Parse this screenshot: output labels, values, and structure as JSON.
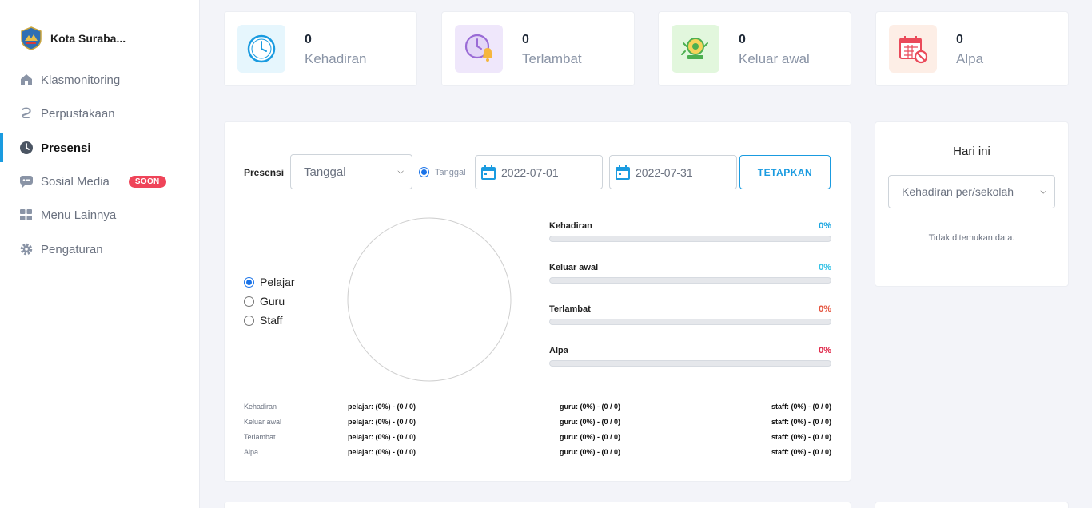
{
  "sidebar": {
    "brand": "Kota Suraba...",
    "items": [
      {
        "label": "Klasmonitoring",
        "icon": "home-icon"
      },
      {
        "label": "Perpustakaan",
        "icon": "library-icon"
      },
      {
        "label": "Presensi",
        "icon": "clock-icon",
        "active": true
      },
      {
        "label": "Sosial Media",
        "icon": "chat-icon",
        "badge": "SOON"
      },
      {
        "label": "Menu Lainnya",
        "icon": "grid-icon"
      },
      {
        "label": "Pengaturan",
        "icon": "gear-icon"
      }
    ]
  },
  "stats": [
    {
      "value": "0",
      "label": "Kehadiran",
      "icon": "clock-icon",
      "bg": "#e6f6fd",
      "color": "#1a9be0"
    },
    {
      "value": "0",
      "label": "Terlambat",
      "icon": "alarm-clock-icon",
      "bg": "#efe7fb",
      "color": "#9a6bd6"
    },
    {
      "value": "0",
      "label": "Keluar awal",
      "icon": "bell-icon",
      "bg": "#e2f7dd",
      "color": "#4caf50"
    },
    {
      "value": "0",
      "label": "Alpa",
      "icon": "calendar-cancel-icon",
      "bg": "#fdeee6",
      "color": "#ea4a5a"
    }
  ],
  "presensi": {
    "label": "Presensi",
    "period_select": "Tanggal",
    "radio_label": "Tanggal",
    "date_from": "2022-07-01",
    "date_to": "2022-07-31",
    "apply_label": "TETAPKAN",
    "roles": [
      {
        "label": "Pelajar",
        "checked": true
      },
      {
        "label": "Guru",
        "checked": false
      },
      {
        "label": "Staff",
        "checked": false
      }
    ],
    "bars": [
      {
        "name": "Kehadiran",
        "pct": "0%",
        "value": 0,
        "color": "#1aa5e0"
      },
      {
        "name": "Keluar awal",
        "pct": "0%",
        "value": 0,
        "color": "#33c2e6"
      },
      {
        "name": "Terlambat",
        "pct": "0%",
        "value": 0,
        "color": "#e5533d"
      },
      {
        "name": "Alpa",
        "pct": "0%",
        "value": 0,
        "color": "#e0294a"
      }
    ],
    "summary": [
      {
        "label": "Kehadiran",
        "pelajar": "pelajar: (0%) - (0 / 0)",
        "guru": "guru: (0%) - (0 / 0)",
        "staff": "staff: (0%) - (0 / 0)"
      },
      {
        "label": "Keluar awal",
        "pelajar": "pelajar: (0%) - (0 / 0)",
        "guru": "guru: (0%) - (0 / 0)",
        "staff": "staff: (0%) - (0 / 0)"
      },
      {
        "label": "Terlambat",
        "pelajar": "pelajar: (0%) - (0 / 0)",
        "guru": "guru: (0%) - (0 / 0)",
        "staff": "staff: (0%) - (0 / 0)"
      },
      {
        "label": "Alpa",
        "pelajar": "pelajar: (0%) - (0 / 0)",
        "guru": "guru: (0%) - (0 / 0)",
        "staff": "staff: (0%) - (0 / 0)"
      }
    ]
  },
  "today": {
    "title": "Hari ini",
    "select": "Kehadiran per/sekolah",
    "empty": "Tidak ditemukan data."
  }
}
